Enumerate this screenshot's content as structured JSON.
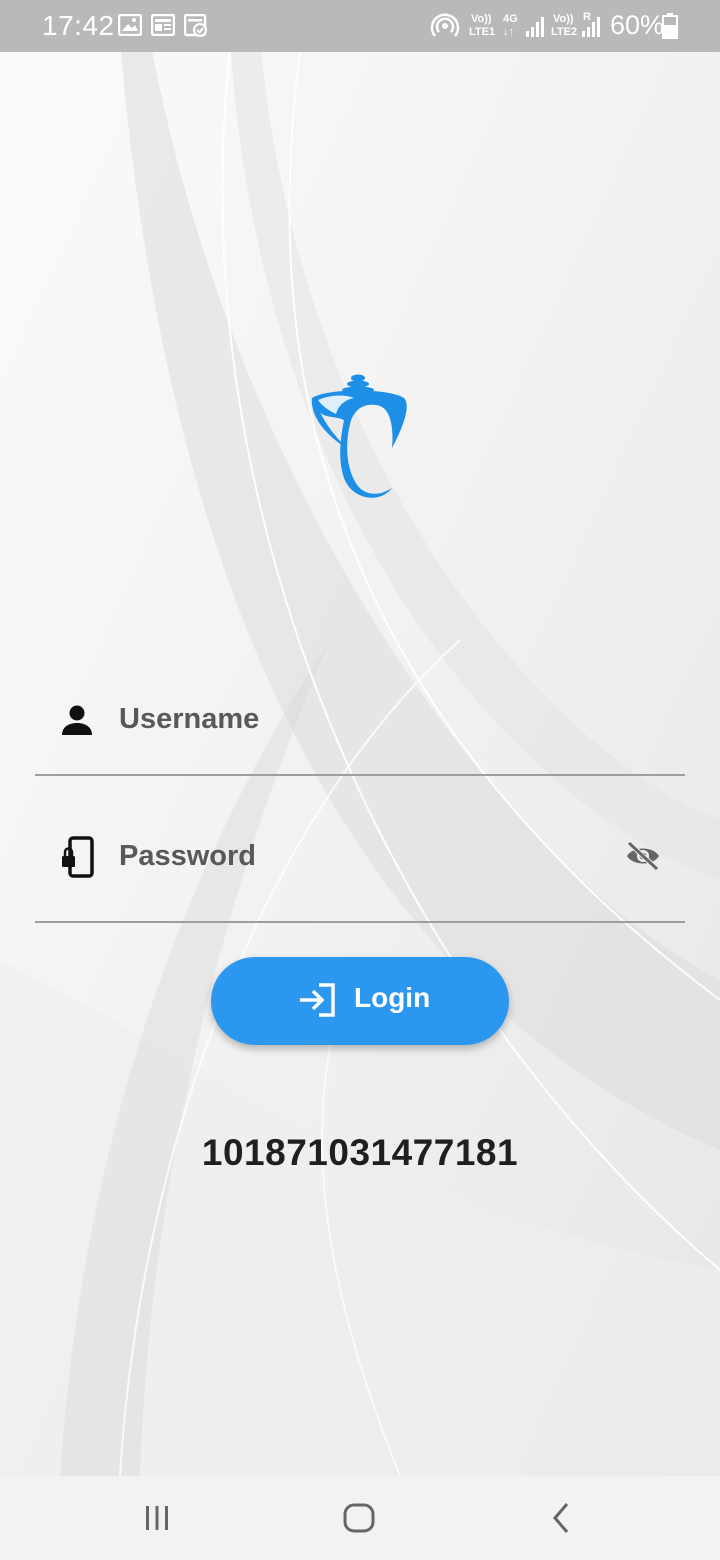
{
  "status_bar": {
    "time": "17:42",
    "battery_percent": "60%",
    "network_label_1": "Vo))",
    "network_sub_1": "LTE1",
    "network_type": "4G",
    "network_label_2": "Vo))",
    "network_sub_2": "LTE2",
    "roaming": "R",
    "icons": [
      "gallery-icon",
      "news-icon",
      "calendar-check-icon",
      "hotspot-icon",
      "signal-icon",
      "battery-icon"
    ]
  },
  "login_form": {
    "username_placeholder": "Username",
    "password_placeholder": "Password",
    "username_value": "",
    "password_value": "",
    "login_label": "Login"
  },
  "device_number": "101871031477181",
  "colors": {
    "accent": "#2b97ee",
    "logo": "#1e8fe6",
    "status_bar": "#b9b9b9",
    "nav_bar": "#f2f2f2"
  },
  "nav_bar": {
    "buttons": [
      "recent-apps-icon",
      "home-icon",
      "back-icon"
    ]
  }
}
